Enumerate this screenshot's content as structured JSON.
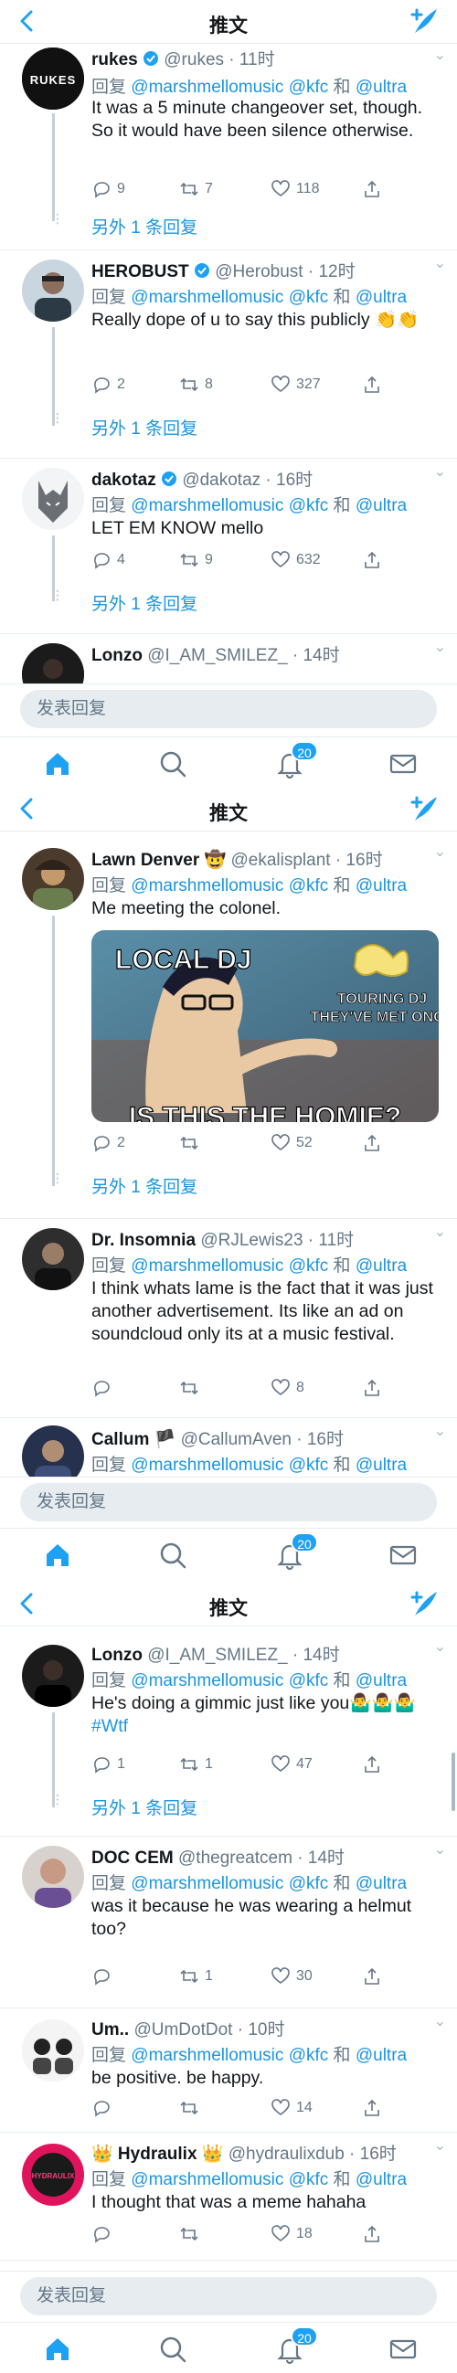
{
  "header": {
    "title": "推文"
  },
  "reply_bar": {
    "placeholder": "发表回复"
  },
  "notifications_badge": "20",
  "reply_prefix": "回复",
  "mentions": [
    "@marshmellomusic",
    "@kfc",
    "和",
    "@ultra"
  ],
  "more_replies": "另外 1 条回复",
  "screen1": {
    "tweets": [
      {
        "name": "rukes",
        "handle": "@rukes · 11时",
        "verified": true,
        "text": "It was a 5 minute changeover set, though. So it would have been silence otherwise.",
        "replies": "9",
        "retweets": "7",
        "likes": "118"
      },
      {
        "name": "HEROBUST",
        "handle": "@Herobust · 12时",
        "verified": true,
        "text": "Really dope of u to say this publicly 👏👏",
        "replies": "2",
        "retweets": "8",
        "likes": "327"
      },
      {
        "name": "dakotaz",
        "handle": "@dakotaz · 16时",
        "verified": true,
        "text": "LET EM KNOW mello",
        "replies": "4",
        "retweets": "9",
        "likes": "632"
      },
      {
        "name": "Lonzo",
        "handle": "@I_AM_SMILEZ_ · 14时"
      }
    ]
  },
  "screen2": {
    "tweets": [
      {
        "name": "Lawn Denver 🤠",
        "handle": "@ekalisplant · 16时",
        "text": "Me meeting the colonel.",
        "meme": {
          "top_left": "LOCAL DJ",
          "right": "TOURING DJ THEY'VE MET ONCE",
          "bottom": "IS THIS THE HOMIE?"
        },
        "replies": "2",
        "retweets": "",
        "likes": "52"
      },
      {
        "name": "Dr. Insomnia",
        "handle": "@RJLewis23 · 11时",
        "text": "I think whats lame is the fact that it was just another advertisement. Its like an ad on soundcloud only its at a music festival.",
        "replies": "",
        "retweets": "",
        "likes": "8"
      },
      {
        "name": "Callum 🏴",
        "handle": "@CallumAven · 16时"
      }
    ]
  },
  "screen3": {
    "tweets": [
      {
        "name": "Lonzo",
        "handle": "@I_AM_SMILEZ_ · 14时",
        "text": "He's doing a gimmic just like you🤷‍♂️🤷‍♂️🤷‍♂️",
        "hashtag": "#Wtf",
        "replies": "1",
        "retweets": "1",
        "likes": "47"
      },
      {
        "name": "DOC CEM",
        "handle": "@thegreatcem · 14时",
        "text": "was it because he was wearing a helmut too?",
        "replies": "",
        "retweets": "1",
        "likes": "30"
      },
      {
        "name": "Um..",
        "handle": "@UmDotDot · 10时",
        "text": "be positive. be happy.",
        "replies": "",
        "retweets": "",
        "likes": "14"
      },
      {
        "name": "👑 Hydraulix 👑",
        "handle": "@hydraulixdub · 16时",
        "text": "I thought that was a meme hahaha",
        "replies": "",
        "retweets": "",
        "likes": "18"
      }
    ]
  },
  "icons": [
    "back-arrow-icon",
    "compose-icon",
    "reply-icon",
    "retweet-icon",
    "like-icon",
    "share-icon",
    "home-icon",
    "search-icon",
    "notifications-icon",
    "messages-icon",
    "verified-icon",
    "chevron-down-icon"
  ],
  "colors": {
    "accent": "#1da1f2",
    "link": "#1b95e0",
    "muted": "#657786",
    "divider": "#e6ecf0"
  }
}
